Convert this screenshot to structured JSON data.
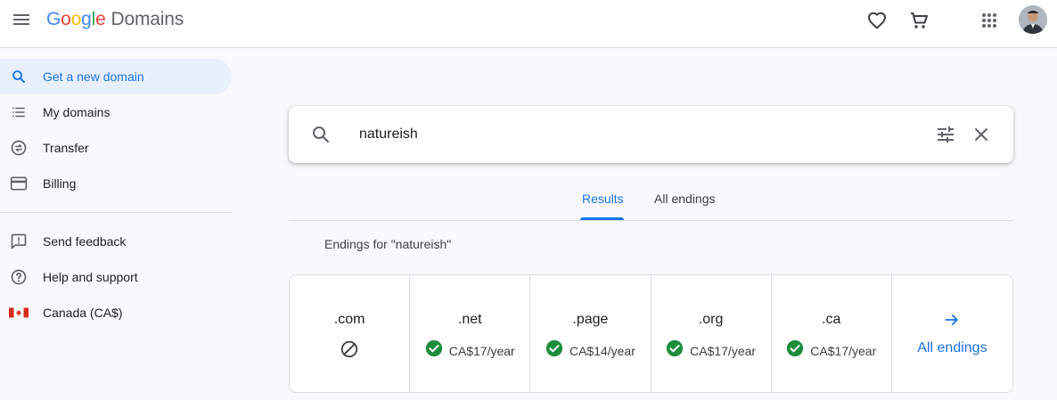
{
  "app": {
    "logo_letters": [
      "G",
      "o",
      "o",
      "g",
      "l",
      "e"
    ],
    "product": "Domains"
  },
  "topbar": {
    "icons": [
      "menu-icon",
      "heart-icon",
      "cart-icon",
      "apps-grid-icon",
      "avatar"
    ]
  },
  "sidebar": {
    "items": [
      {
        "label": "Get a new domain",
        "icon": "search-icon",
        "active": true
      },
      {
        "label": "My domains",
        "icon": "list-icon"
      },
      {
        "label": "Transfer",
        "icon": "transfer-icon"
      },
      {
        "label": "Billing",
        "icon": "credit-card-icon"
      },
      {
        "label": "Send feedback",
        "icon": "feedback-icon"
      },
      {
        "label": "Help and support",
        "icon": "help-icon"
      },
      {
        "label": "Canada (CA$)",
        "icon": "canada-flag-icon"
      }
    ]
  },
  "search": {
    "value": "natureish"
  },
  "tabs": [
    {
      "label": "Results",
      "active": true
    },
    {
      "label": "All endings"
    }
  ],
  "endings_label": "Endings for \"natureish\"",
  "endings": [
    {
      "tld": ".com",
      "available": false,
      "price": ""
    },
    {
      "tld": ".net",
      "available": true,
      "price": "CA$17/year"
    },
    {
      "tld": ".page",
      "available": true,
      "price": "CA$14/year"
    },
    {
      "tld": ".org",
      "available": true,
      "price": "CA$17/year"
    },
    {
      "tld": ".ca",
      "available": true,
      "price": "CA$17/year"
    }
  ],
  "all_endings_link": "All endings",
  "colors": {
    "accent": "#1a73e8",
    "available_green": "#1e8e3e",
    "active_nav_bg": "#e8f0fe"
  }
}
